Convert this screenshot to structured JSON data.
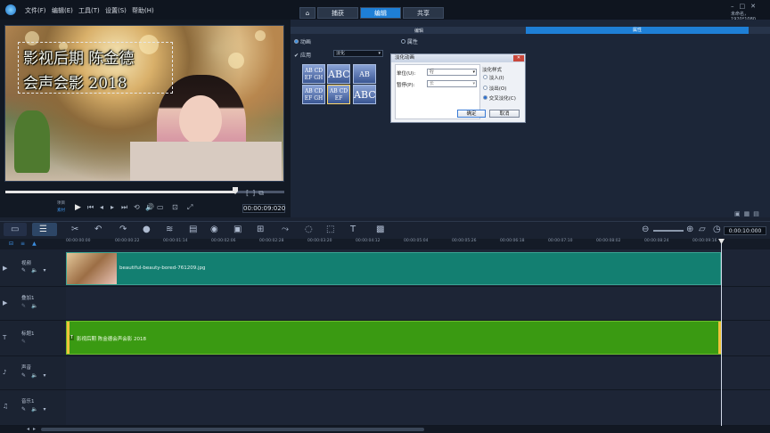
{
  "menu": {
    "file": "文件(F)",
    "edit": "编辑(E)",
    "tools": "工具(T)",
    "settings": "设置(S)",
    "help": "帮助(H)"
  },
  "tabs": {
    "capture": "捕获",
    "edit": "编辑",
    "share": "共享"
  },
  "project_info": "未命名，1920*1080",
  "preview": {
    "caption_line1": "影视后期 陈金德",
    "caption_line2": "会声会影 2018",
    "timecode": "00:00:09:020",
    "project_label": "项目",
    "clip_label": "素材"
  },
  "options": {
    "header": "编辑",
    "attributes": "属性",
    "tab_edit": "编辑",
    "tab_properties": "属性",
    "motion": "动画",
    "apply": "应用",
    "fade": "淡化",
    "dropdown_value": "淡化"
  },
  "tiles": [
    {
      "text": "AB CD EF GH"
    },
    {
      "text": "ABC"
    },
    {
      "text": "AB"
    },
    {
      "text": "AB CD EF GH"
    },
    {
      "text": "AB CD EF"
    },
    {
      "text": "ABC"
    }
  ],
  "dialog": {
    "title": "淡化动画",
    "unit_label": "单位(U):",
    "unit_value": "行",
    "pause_label": "暂停(P):",
    "pause_value": "长",
    "style_label": "淡化样式",
    "opt_in": "淡入(I)",
    "opt_out": "淡出(O)",
    "opt_cross": "交叉淡化(C)",
    "ok": "确定",
    "cancel": "取消"
  },
  "timeline": {
    "ruler": [
      "00:00:00:00",
      "00:00:00:22",
      "00:00:01:14",
      "00:00:02:06",
      "00:00:02:28",
      "00:00:03:20",
      "00:00:04:12",
      "00:00:05:04",
      "00:00:05:26",
      "00:00:06:18",
      "00:00:07:10",
      "00:00:08:02",
      "00:00:08:24",
      "00:00:09:16"
    ],
    "zoom_timecode": "0:00:10:000",
    "tracks": {
      "video": "视频",
      "overlay": "叠加1",
      "title": "标题1",
      "voice": "声音",
      "music": "音乐1"
    },
    "video_clip": "beautiful-beauty-bored-761209.jpg",
    "title_clip": "影视后期 陈金德会声会影 2018"
  }
}
